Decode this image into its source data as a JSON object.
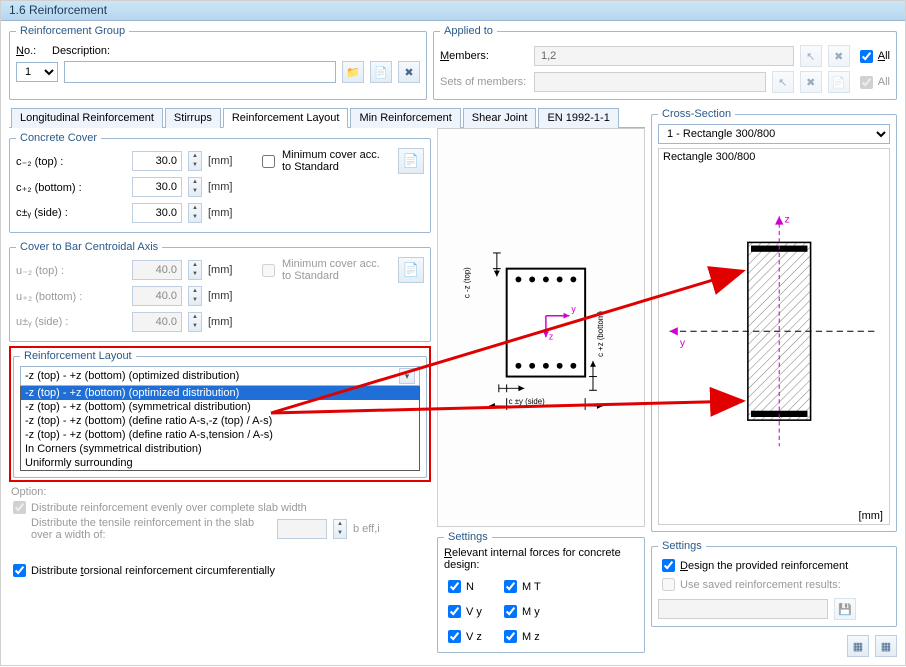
{
  "window_title": "1.6 Reinforcement",
  "reinf_group": {
    "legend": "Reinforcement Group",
    "no_label": "No.:",
    "description_label": "Description:",
    "no_value": "1",
    "description_value": ""
  },
  "applied_to": {
    "legend": "Applied to",
    "members_label": "Members:",
    "members_value": "1,2",
    "sets_label": "Sets of members:",
    "sets_value": "",
    "all_label": "All"
  },
  "tabs": [
    "Longitudinal Reinforcement",
    "Stirrups",
    "Reinforcement Layout",
    "Min Reinforcement",
    "Shear Joint",
    "EN 1992-1-1"
  ],
  "active_tab_index": 2,
  "concrete_cover": {
    "legend": "Concrete Cover",
    "rows": [
      {
        "label": "c₋₂ (top) :",
        "value": "30.0",
        "unit": "[mm]"
      },
      {
        "label": "c₊₂ (bottom) :",
        "value": "30.0",
        "unit": "[mm]"
      },
      {
        "label": "c±ᵧ (side) :",
        "value": "30.0",
        "unit": "[mm]"
      }
    ],
    "min_cover_label": "Minimum cover acc. to Standard"
  },
  "cover_bar": {
    "legend": "Cover to Bar Centroidal Axis",
    "rows": [
      {
        "label": "u₋₂ (top) :",
        "value": "40.0",
        "unit": "[mm]"
      },
      {
        "label": "u₊₂ (bottom) :",
        "value": "40.0",
        "unit": "[mm]"
      },
      {
        "label": "u±ᵧ (side) :",
        "value": "40.0",
        "unit": "[mm]"
      }
    ],
    "min_cover_label": "Minimum cover acc. to Standard"
  },
  "reinf_layout": {
    "legend": "Reinforcement Layout",
    "selected": "-z (top) - +z (bottom) (optimized distribution)",
    "options": [
      "-z (top) - +z (bottom) (optimized distribution)",
      "-z (top) - +z (bottom) (symmetrical distribution)",
      "-z (top) - +z (bottom) (define ratio A-s,-z (top) / A-s)",
      "-z (top) - +z (bottom) (define ratio A-s,tension / A-s)",
      "In Corners (symmetrical distribution)",
      "Uniformly surrounding"
    ]
  },
  "option_block": {
    "legend": "Option:",
    "dist_slab": "Distribute reinforcement evenly over complete slab width",
    "dist_tensile": "Distribute the tensile reinforcement in the slab over a width of:",
    "beff": "b eff,i",
    "torsional": "Distribute torsional reinforcement circumferentially"
  },
  "settings_left": {
    "legend": "Settings",
    "desc": "Relevant internal forces for concrete design:",
    "forces": [
      "N",
      "M T",
      "V y",
      "M y",
      "V z",
      "M z"
    ]
  },
  "cross_section": {
    "legend": "Cross-Section",
    "select_value": "1 - Rectangle 300/800",
    "title": "Rectangle 300/800",
    "axis_z": "z",
    "axis_y": "y",
    "unit": "[mm]"
  },
  "settings_right": {
    "legend": "Settings",
    "design_label": "Design the provided reinforcement",
    "use_saved_label": "Use saved reinforcement results:"
  },
  "diagram_labels": {
    "cz_top": "c -z (top)",
    "cz_bottom": "c +z (bottom)",
    "cy_side": "c ±y (side)",
    "y": "y",
    "z": "z"
  }
}
